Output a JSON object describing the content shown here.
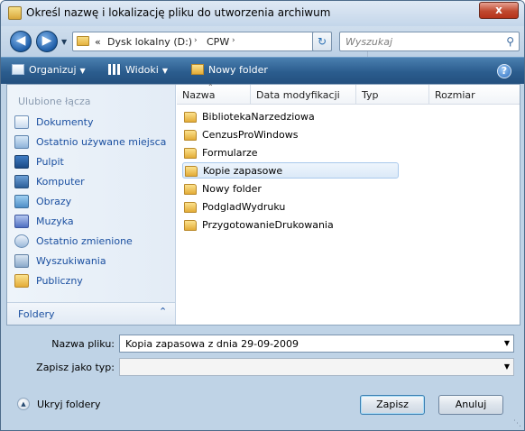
{
  "window": {
    "title": "Określ nazwę i lokalizację pliku do utworzenia archiwum",
    "close_label": "x"
  },
  "navigation": {
    "back_icon": "arrow-left-icon",
    "forward_icon": "arrow-right-icon",
    "breadcrumb": {
      "overflow": "«",
      "segments": [
        "Dysk lokalny (D:)",
        "CPW"
      ],
      "separator": "›"
    },
    "search": {
      "placeholder": "Wyszukaj"
    }
  },
  "toolbar": {
    "organize_label": "Organizuj",
    "views_label": "Widoki",
    "new_folder_label": "Nowy folder",
    "help_label": "?"
  },
  "sidebar": {
    "header": "Ulubione łącza",
    "items": [
      {
        "label": "Dokumenty",
        "icon": "documents-icon"
      },
      {
        "label": "Ostatnio używane miejsca",
        "icon": "recent-places-icon"
      },
      {
        "label": "Pulpit",
        "icon": "desktop-icon"
      },
      {
        "label": "Komputer",
        "icon": "computer-icon"
      },
      {
        "label": "Obrazy",
        "icon": "pictures-icon"
      },
      {
        "label": "Muzyka",
        "icon": "music-icon"
      },
      {
        "label": "Ostatnio zmienione",
        "icon": "recently-changed-icon"
      },
      {
        "label": "Wyszukiwania",
        "icon": "searches-icon"
      },
      {
        "label": "Publiczny",
        "icon": "public-folder-icon"
      }
    ],
    "folders_label": "Foldery"
  },
  "filelist": {
    "columns": [
      "Nazwa",
      "Data modyfikacji",
      "Typ",
      "Rozmiar"
    ],
    "items": [
      {
        "name": "BibliotekaNarzedziowa",
        "selected": false
      },
      {
        "name": "CenzusProWindows",
        "selected": false
      },
      {
        "name": "Formularze",
        "selected": false
      },
      {
        "name": "Kopie zapasowe",
        "selected": true
      },
      {
        "name": "Nowy folder",
        "selected": false
      },
      {
        "name": "PodgladWydruku",
        "selected": false
      },
      {
        "name": "PrzygotowanieDrukowania",
        "selected": false
      }
    ]
  },
  "form": {
    "filename_label": "Nazwa pliku:",
    "filename_value": "Kopia zapasowa z dnia 29-09-2009",
    "savetype_label": "Zapisz jako typ:",
    "savetype_value": ""
  },
  "footer": {
    "hide_folders_label": "Ukryj foldery",
    "save_label": "Zapisz",
    "cancel_label": "Anuluj"
  },
  "colors": {
    "link": "#1a4fa0",
    "command_bar": "#2b5d8e",
    "selection": "#dbe9f8"
  }
}
